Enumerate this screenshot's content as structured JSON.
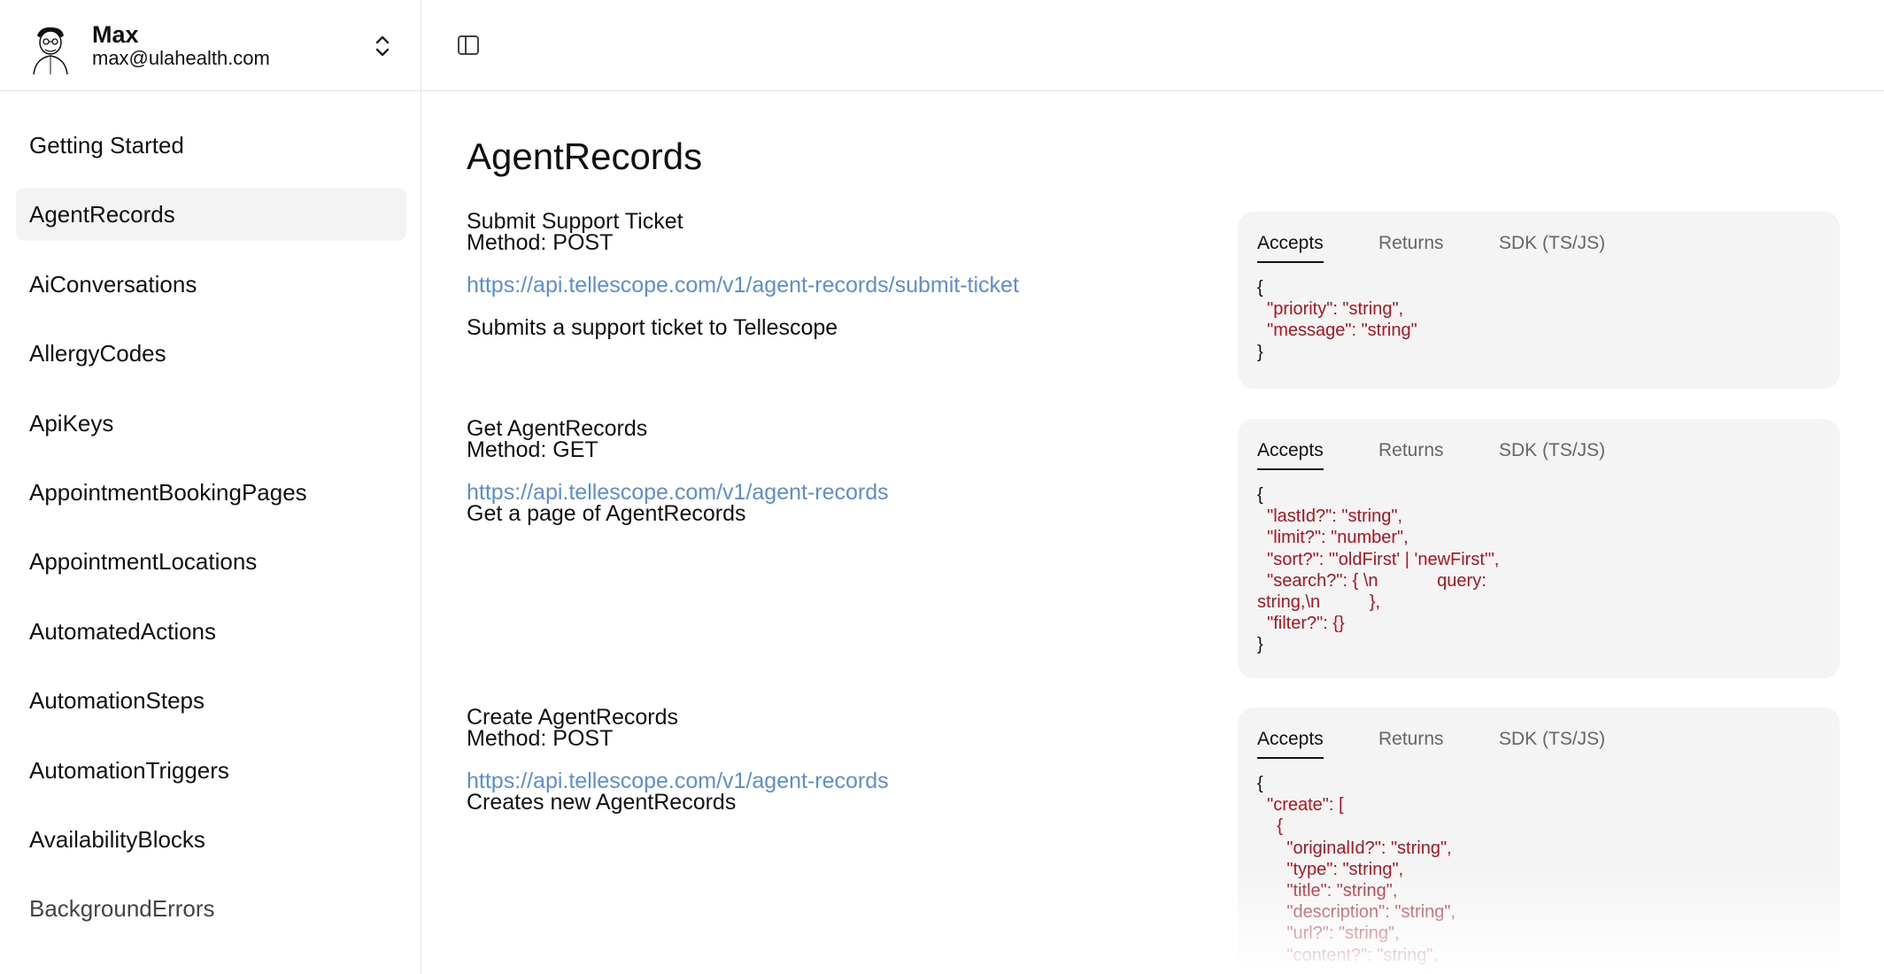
{
  "user": {
    "name": "Max",
    "email": "max@ulahealth.com"
  },
  "sidebar": {
    "items": [
      {
        "label": "Getting Started"
      },
      {
        "label": "AgentRecords",
        "active": true
      },
      {
        "label": "AiConversations"
      },
      {
        "label": "AllergyCodes"
      },
      {
        "label": "ApiKeys"
      },
      {
        "label": "AppointmentBookingPages"
      },
      {
        "label": "AppointmentLocations"
      },
      {
        "label": "AutomatedActions"
      },
      {
        "label": "AutomationSteps"
      },
      {
        "label": "AutomationTriggers"
      },
      {
        "label": "AvailabilityBlocks"
      },
      {
        "label": "BackgroundErrors"
      }
    ]
  },
  "main": {
    "title": "AgentRecords",
    "endpoints": [
      {
        "name": "Submit Support Ticket",
        "method": "Method: POST",
        "url": "https://api.tellescope.com/v1/agent-records/submit-ticket",
        "description": "Submits a support ticket to Tellescope",
        "tabs": [
          "Accepts",
          "Returns",
          "SDK (TS/JS)"
        ],
        "active_tab": "Accepts",
        "code": [
          {
            "text": "{",
            "kind": "punct"
          },
          {
            "text": "  \"priority\": \"string\",",
            "kind": "key"
          },
          {
            "text": "  \"message\": \"string\"",
            "kind": "key"
          },
          {
            "text": "}",
            "kind": "punct"
          }
        ]
      },
      {
        "name": "Get AgentRecords",
        "method": "Method: GET",
        "url": "https://api.tellescope.com/v1/agent-records",
        "description": "Get a page of AgentRecords",
        "tabs": [
          "Accepts",
          "Returns",
          "SDK (TS/JS)"
        ],
        "active_tab": "Accepts",
        "code": [
          {
            "text": "{",
            "kind": "punct"
          },
          {
            "text": "  \"lastId?\": \"string\",",
            "kind": "key"
          },
          {
            "text": "  \"limit?\": \"number\",",
            "kind": "key"
          },
          {
            "text": "  \"sort?\": \"'oldFirst' | 'newFirst'\",",
            "kind": "key"
          },
          {
            "text": "  \"search?\": { \\n            query:",
            "kind": "key"
          },
          {
            "text": "string,\\n          },",
            "kind": "key"
          },
          {
            "text": "  \"filter?\": {}",
            "kind": "key"
          },
          {
            "text": "}",
            "kind": "punct"
          }
        ]
      },
      {
        "name": "Create AgentRecords",
        "method": "Method: POST",
        "url": "https://api.tellescope.com/v1/agent-records",
        "description": "Creates new AgentRecords",
        "tabs": [
          "Accepts",
          "Returns",
          "SDK (TS/JS)"
        ],
        "active_tab": "Accepts",
        "code": [
          {
            "text": "{",
            "kind": "punct"
          },
          {
            "text": "  \"create\": [",
            "kind": "key"
          },
          {
            "text": "    {",
            "kind": "key"
          },
          {
            "text": "      \"originalId?\": \"string\",",
            "kind": "key"
          },
          {
            "text": "      \"type\": \"string\",",
            "kind": "key"
          },
          {
            "text": "      \"title\": \"string\",",
            "kind": "key"
          },
          {
            "text": "      \"description\": \"string\",",
            "kind": "key"
          },
          {
            "text": "      \"url?\": \"string\",",
            "kind": "key"
          },
          {
            "text": "      \"content?\": \"string\",",
            "kind": "key"
          }
        ]
      }
    ]
  },
  "colors": {
    "link": "#5b8fd4",
    "code_key": "#b2121b",
    "card_bg": "#f4f4f4",
    "active_nav_bg": "#f3f3f3"
  },
  "icons": [
    "avatar-illustration",
    "chevron-up-down-icon",
    "sidebar-panel-icon"
  ]
}
